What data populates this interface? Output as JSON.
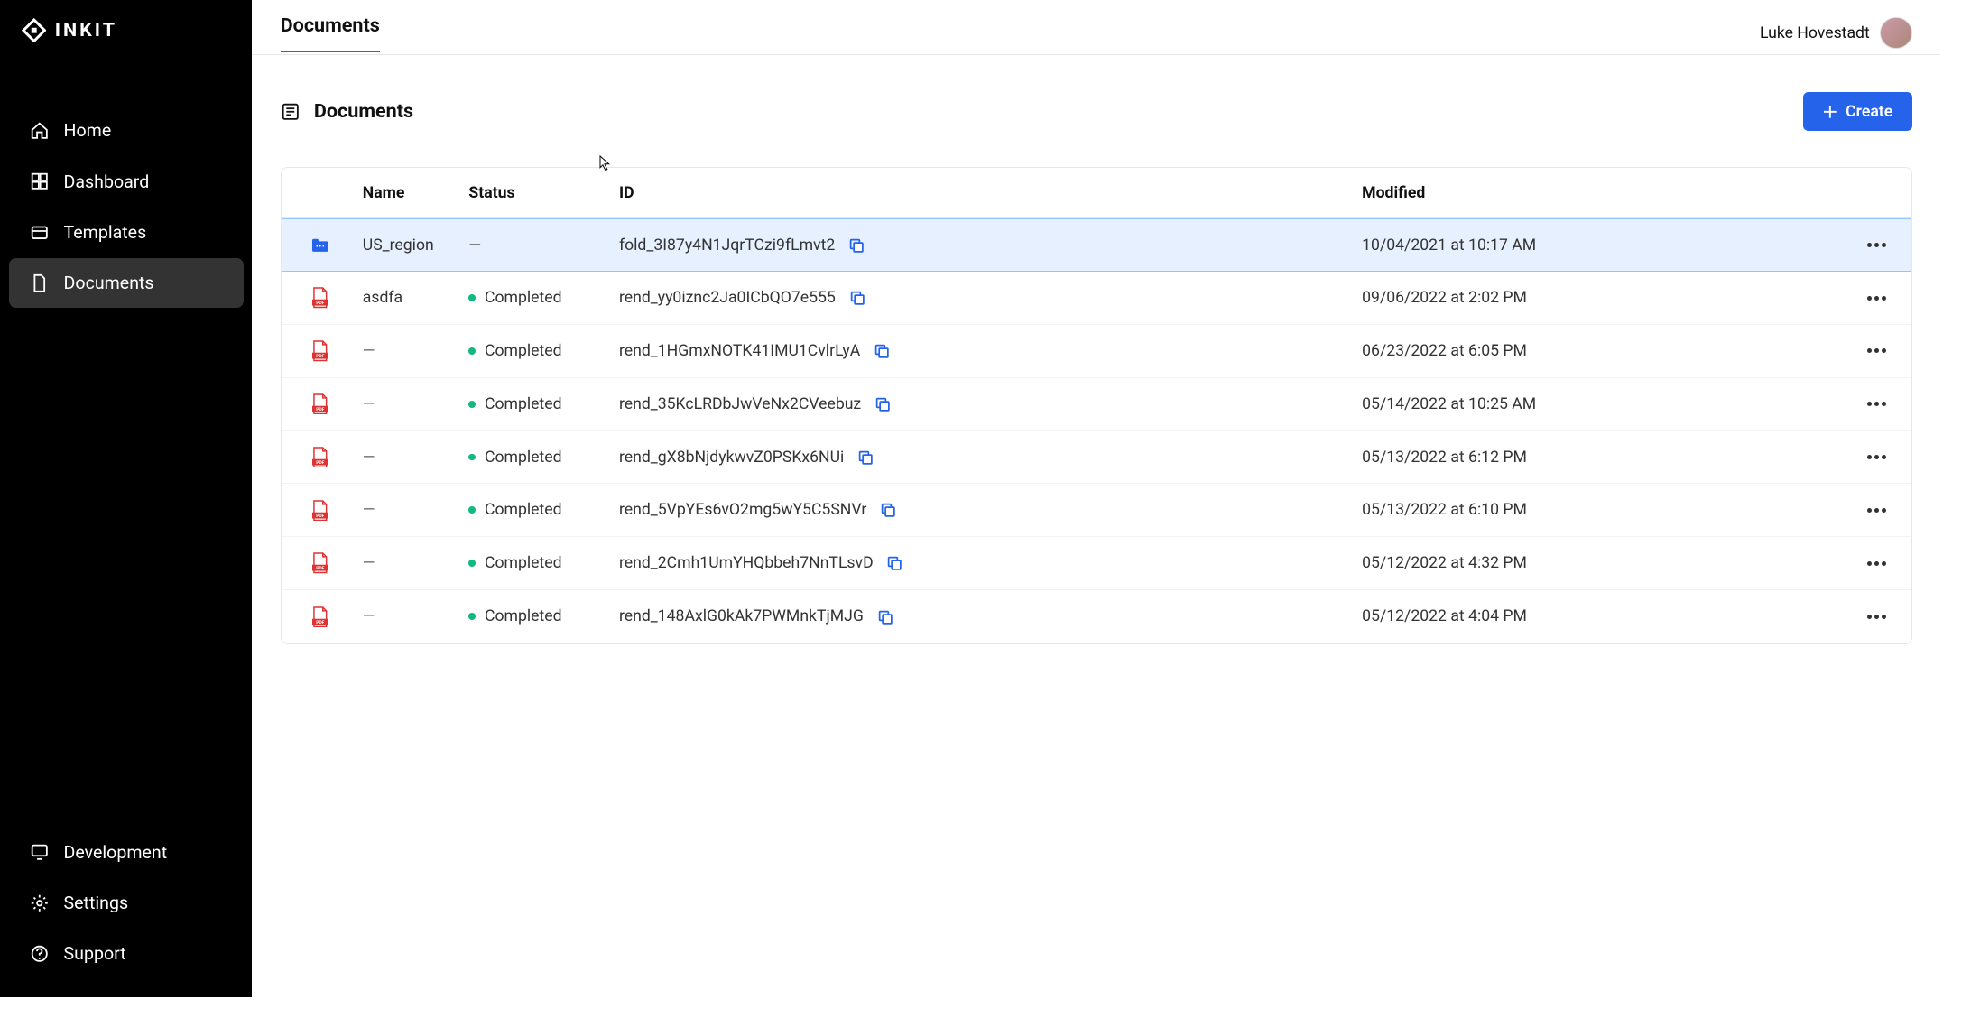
{
  "brand": "INKIT",
  "user": {
    "name": "Luke Hovestadt"
  },
  "topbar": {
    "title": "Documents"
  },
  "nav": {
    "top": [
      {
        "label": "Home",
        "icon": "home"
      },
      {
        "label": "Dashboard",
        "icon": "dashboard"
      },
      {
        "label": "Templates",
        "icon": "templates"
      },
      {
        "label": "Documents",
        "icon": "documents",
        "active": true
      }
    ],
    "bottom": [
      {
        "label": "Development",
        "icon": "development"
      },
      {
        "label": "Settings",
        "icon": "settings"
      },
      {
        "label": "Support",
        "icon": "support"
      }
    ]
  },
  "page": {
    "title": "Documents",
    "create_label": "Create"
  },
  "table": {
    "headers": {
      "name": "Name",
      "status": "Status",
      "id": "ID",
      "modified": "Modified"
    },
    "rows": [
      {
        "type": "folder",
        "name": "US_region",
        "status": "—",
        "id": "fold_3I87y4N1JqrTCzi9fLmvt2",
        "modified": "10/04/2021 at 10:17 AM",
        "selected": true
      },
      {
        "type": "pdf",
        "name": "asdfa",
        "status": "Completed",
        "id": "rend_yy0iznc2Ja0ICbQO7e555",
        "modified": "09/06/2022 at 2:02 PM"
      },
      {
        "type": "pdf",
        "name": "—",
        "status": "Completed",
        "id": "rend_1HGmxNOTK41IMU1CvlrLyA",
        "modified": "06/23/2022 at 6:05 PM"
      },
      {
        "type": "pdf",
        "name": "—",
        "status": "Completed",
        "id": "rend_35KcLRDbJwVeNx2CVeebuz",
        "modified": "05/14/2022 at 10:25 AM"
      },
      {
        "type": "pdf",
        "name": "—",
        "status": "Completed",
        "id": "rend_gX8bNjdykwvZ0PSKx6NUi",
        "modified": "05/13/2022 at 6:12 PM"
      },
      {
        "type": "pdf",
        "name": "—",
        "status": "Completed",
        "id": "rend_5VpYEs6vO2mg5wY5C5SNVr",
        "modified": "05/13/2022 at 6:10 PM"
      },
      {
        "type": "pdf",
        "name": "—",
        "status": "Completed",
        "id": "rend_2Cmh1UmYHQbbeh7NnTLsvD",
        "modified": "05/12/2022 at 4:32 PM"
      },
      {
        "type": "pdf",
        "name": "—",
        "status": "Completed",
        "id": "rend_148AxlG0kAk7PWMnkTjMJG",
        "modified": "05/12/2022 at 4:04 PM"
      }
    ]
  }
}
